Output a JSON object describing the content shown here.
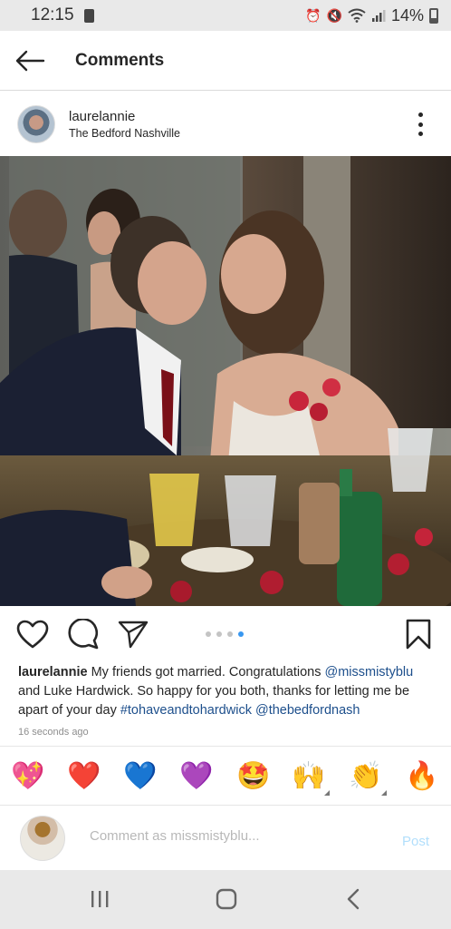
{
  "status_bar": {
    "time": "12:15",
    "battery": "14%",
    "icons": [
      "alarm-icon",
      "mute-icon",
      "wifi-icon",
      "signal-icon",
      "battery-icon"
    ]
  },
  "header": {
    "title": "Comments",
    "back_icon": "arrow-left-icon"
  },
  "post": {
    "username": "laurelannie",
    "location": "The Bedford Nashville",
    "carousel": {
      "count": 4,
      "active_index": 4
    },
    "caption": {
      "username": "laurelannie",
      "text_1": " My friends got married. Congratulations ",
      "mention_1": "@missmistyblu",
      "text_2": " and Luke Hardwick. So happy for you both, thanks for letting me be apart of your day ",
      "hashtag": "#tohaveandtohardwick",
      "text_3": " ",
      "mention_2": "@thebedfordnash"
    },
    "timestamp": "16 seconds ago"
  },
  "emoji_bar": [
    {
      "name": "sparkling-heart",
      "glyph": "💖"
    },
    {
      "name": "red-heart",
      "glyph": "❤️"
    },
    {
      "name": "blue-heart",
      "glyph": "💙"
    },
    {
      "name": "purple-heart",
      "glyph": "💜"
    },
    {
      "name": "star-struck",
      "glyph": "🤩"
    },
    {
      "name": "raising-hands",
      "glyph": "🙌"
    },
    {
      "name": "clapping-hands",
      "glyph": "👏"
    },
    {
      "name": "fire",
      "glyph": "🔥"
    }
  ],
  "comment_box": {
    "placeholder": "Comment as missmistyblu...",
    "post_label": "Post"
  },
  "colors": {
    "accent_blue": "#3897f0",
    "link_blue": "#1d4f8c",
    "post_disabled": "#b2dffc",
    "status_bg": "#e9e9e9"
  }
}
